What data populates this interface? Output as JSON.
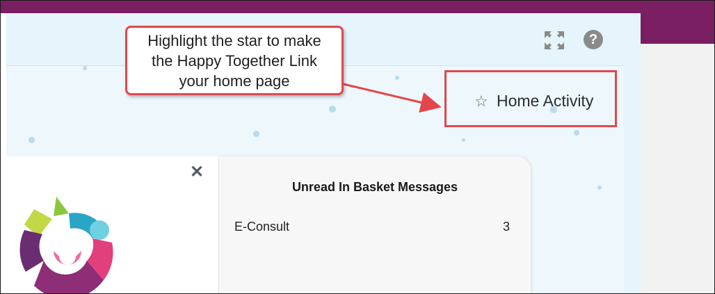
{
  "header": {
    "expand_icon": "expand-icon",
    "help_icon": "help-icon",
    "help_glyph": "?"
  },
  "callout": {
    "lines": [
      "Highlight the star to make",
      "the Happy Together Link",
      "your home page"
    ]
  },
  "home_activity": {
    "star_icon": "star-outline-icon",
    "star_glyph": "☆",
    "label": "Home Activity"
  },
  "widget": {
    "close_icon": "close-icon",
    "close_glyph": "✕",
    "title": "Unread In Basket Messages",
    "rows": [
      {
        "label": "E-Consult",
        "count": "3"
      }
    ]
  },
  "colors": {
    "brand_purple": "#7b1f63",
    "highlight_red": "#e2474c",
    "panel_blue": "#e6f4fb"
  }
}
